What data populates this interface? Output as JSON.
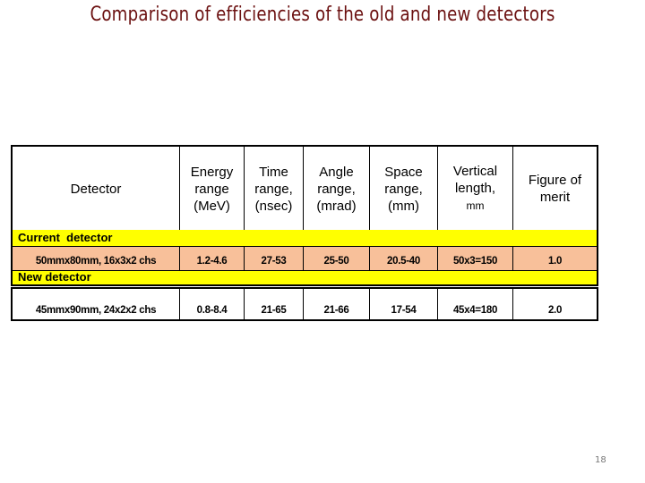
{
  "slide": {
    "title": "Comparison of efficiencies of the old and new detectors",
    "page_number": "18"
  },
  "table": {
    "headers": [
      {
        "line1": "Detector",
        "line2": "",
        "line3": ""
      },
      {
        "line1": "Energy",
        "line2": "range",
        "line3": "(MeV)"
      },
      {
        "line1": "Time",
        "line2": "range,",
        "line3": "(nsec)"
      },
      {
        "line1": "Angle",
        "line2": "range,",
        "line3": "(mrad)"
      },
      {
        "line1": "Space",
        "line2": "range,",
        "line3": "(mm)"
      },
      {
        "line1": "Vertical",
        "line2": "length,",
        "line3": "mm"
      },
      {
        "line1": "Figure of",
        "line2": "merit",
        "line3": ""
      }
    ],
    "sections": [
      {
        "label": "Current  detector",
        "row": [
          "50mmx80mm, 16x3x2 chs",
          "1.2-4.6",
          "27-53",
          "25-50",
          "20.5-40",
          "50x3=150",
          "1.0"
        ]
      },
      {
        "label": "New detector",
        "row": [
          "45mmx90mm, 24x2x2 chs",
          "0.8-8.4",
          "21-65",
          "21-66",
          "17-54",
          "45x4=180",
          "2.0"
        ]
      }
    ]
  },
  "colors": {
    "title": "#6b1010",
    "section_band": "#ffff00",
    "current_row": "#f8c09a",
    "new_row": "#ffffff"
  }
}
